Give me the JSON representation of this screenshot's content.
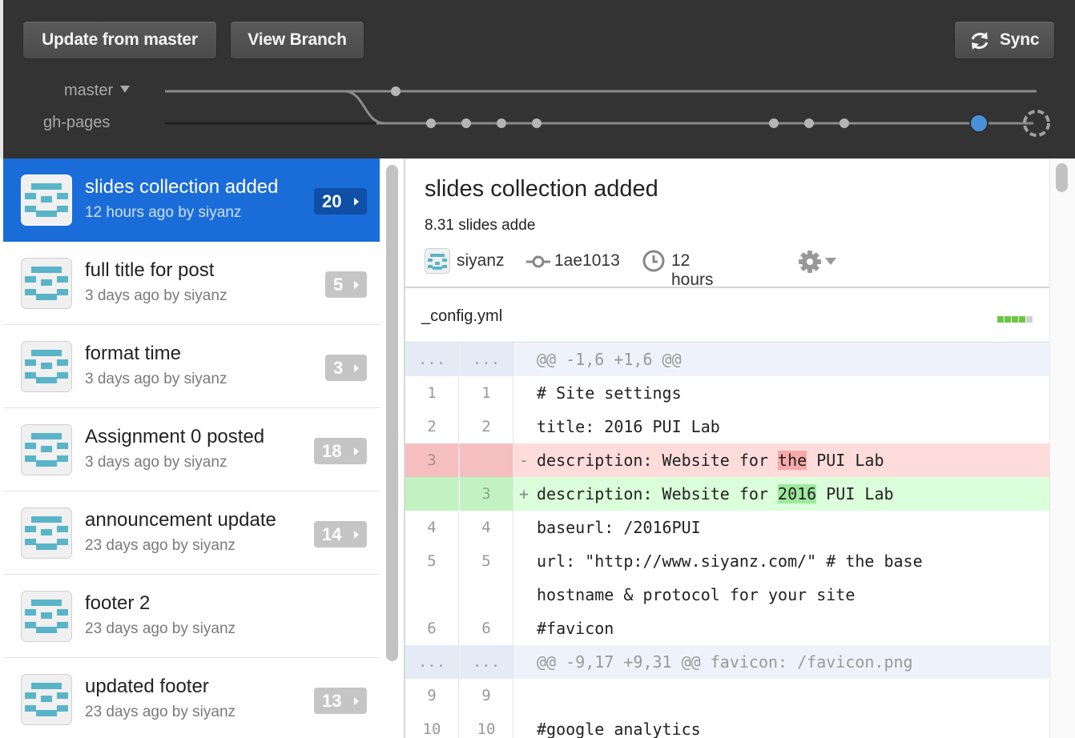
{
  "toolbar": {
    "update_label": "Update from master",
    "view_branch_label": "View Branch",
    "sync_label": "Sync",
    "sync_icon": "sync-icon"
  },
  "branches": {
    "master": "master",
    "gh_pages": "gh-pages"
  },
  "commits": [
    {
      "title": "slides collection added",
      "meta": "12 hours ago by siyanz",
      "count": "20",
      "selected": true
    },
    {
      "title": "full title for post",
      "meta": "3 days ago by siyanz",
      "count": "5"
    },
    {
      "title": "format time",
      "meta": "3 days ago by siyanz",
      "count": "3"
    },
    {
      "title": "Assignment 0 posted",
      "meta": "3 days ago by siyanz",
      "count": "18"
    },
    {
      "title": "announcement update",
      "meta": "23 days ago by siyanz",
      "count": "14"
    },
    {
      "title": "footer 2",
      "meta": "23 days ago by siyanz",
      "count": ""
    },
    {
      "title": "updated footer",
      "meta": "23 days ago by siyanz",
      "count": "13"
    }
  ],
  "detail": {
    "title": "slides collection added",
    "description": "8.31 slides adde",
    "author": "siyanz",
    "sha": "1ae1013",
    "time": "12 hours ago"
  },
  "file": {
    "name": "_config.yml",
    "diffstat": {
      "added_blocks": 4,
      "neutral_blocks": 1
    }
  },
  "diff": [
    {
      "type": "hunk",
      "old": "...",
      "new": "...",
      "text": "@@ -1,6 +1,6 @@"
    },
    {
      "type": "ctx",
      "old": "1",
      "new": "1",
      "text": "# Site settings"
    },
    {
      "type": "ctx",
      "old": "2",
      "new": "2",
      "text": "title: 2016 PUI Lab"
    },
    {
      "type": "del",
      "old": "3",
      "new": "",
      "sign": "-",
      "pre": "description: Website for ",
      "hl": "the",
      "post": " PUI Lab"
    },
    {
      "type": "add",
      "old": "",
      "new": "3",
      "sign": "+",
      "pre": "description: Website for ",
      "hl": "2016",
      "post": " PUI Lab"
    },
    {
      "type": "ctx",
      "old": "4",
      "new": "4",
      "text": "baseurl: /2016PUI"
    },
    {
      "type": "ctx",
      "old": "5",
      "new": "5",
      "text": "url: \"http://www.siyanz.com/\" # the base",
      "text2": "hostname & protocol for your site"
    },
    {
      "type": "ctx",
      "old": "6",
      "new": "6",
      "text": "#favicon"
    },
    {
      "type": "hunk",
      "old": "...",
      "new": "...",
      "text": "@@ -9,17 +9,31 @@ favicon: /favicon.png"
    },
    {
      "type": "ctx",
      "old": "9",
      "new": "9",
      "text": ""
    },
    {
      "type": "ctx",
      "old": "10",
      "new": "10",
      "text": "#google analytics"
    }
  ],
  "colors": {
    "toolbar_bg": "#333333",
    "selected_bg": "#1a6dd8",
    "avatar_teal": "#5ab4c8",
    "current_commit": "#4a90d9"
  }
}
